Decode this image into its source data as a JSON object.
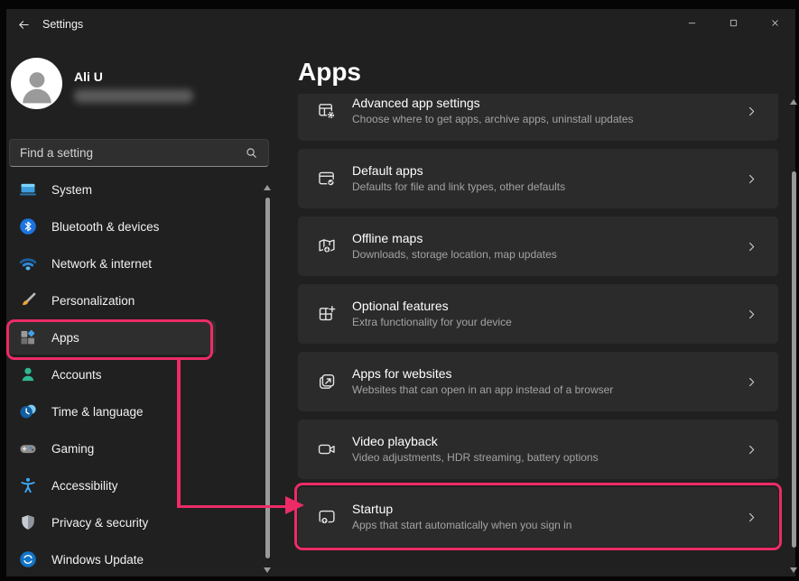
{
  "window": {
    "title": "Settings"
  },
  "titlebar": {
    "controls": [
      "minimize",
      "maximize",
      "close"
    ]
  },
  "user": {
    "name": "Ali U",
    "email_hidden": true
  },
  "search": {
    "placeholder": "Find a setting"
  },
  "sidebar": {
    "items": [
      {
        "label": "System",
        "icon": "system-icon",
        "selected": false
      },
      {
        "label": "Bluetooth & devices",
        "icon": "bluetooth-icon",
        "selected": false
      },
      {
        "label": "Network & internet",
        "icon": "network-icon",
        "selected": false
      },
      {
        "label": "Personalization",
        "icon": "personalization-icon",
        "selected": false
      },
      {
        "label": "Apps",
        "icon": "apps-icon",
        "selected": true
      },
      {
        "label": "Accounts",
        "icon": "accounts-icon",
        "selected": false
      },
      {
        "label": "Time & language",
        "icon": "time-language-icon",
        "selected": false
      },
      {
        "label": "Gaming",
        "icon": "gaming-icon",
        "selected": false
      },
      {
        "label": "Accessibility",
        "icon": "accessibility-icon",
        "selected": false
      },
      {
        "label": "Privacy & security",
        "icon": "privacy-security-icon",
        "selected": false
      },
      {
        "label": "Windows Update",
        "icon": "windows-update-icon",
        "selected": false
      }
    ]
  },
  "main": {
    "heading": "Apps",
    "rows": [
      {
        "title": "Advanced app settings",
        "subtitle": "Choose where to get apps, archive apps, uninstall updates",
        "icon": "advanced-app-settings-icon",
        "highlighted": false
      },
      {
        "title": "Default apps",
        "subtitle": "Defaults for file and link types, other defaults",
        "icon": "default-apps-icon",
        "highlighted": false
      },
      {
        "title": "Offline maps",
        "subtitle": "Downloads, storage location, map updates",
        "icon": "offline-maps-icon",
        "highlighted": false
      },
      {
        "title": "Optional features",
        "subtitle": "Extra functionality for your device",
        "icon": "optional-features-icon",
        "highlighted": false
      },
      {
        "title": "Apps for websites",
        "subtitle": "Websites that can open in an app instead of a browser",
        "icon": "apps-for-websites-icon",
        "highlighted": false
      },
      {
        "title": "Video playback",
        "subtitle": "Video adjustments, HDR streaming, battery options",
        "icon": "video-playback-icon",
        "highlighted": false
      },
      {
        "title": "Startup",
        "subtitle": "Apps that start automatically when you sign in",
        "icon": "startup-icon",
        "highlighted": true
      }
    ]
  },
  "annotation": {
    "color": "#ED2B67",
    "highlights": [
      "Apps sidebar item",
      "Startup row"
    ]
  },
  "colors": {
    "window_bg": "#202020",
    "card_bg": "#2b2b2b",
    "selected_item_bg": "#2e2e2e",
    "primary_text": "#ffffff",
    "secondary_text": "#a3a3a3",
    "annotation_pink": "#ED2B67"
  }
}
